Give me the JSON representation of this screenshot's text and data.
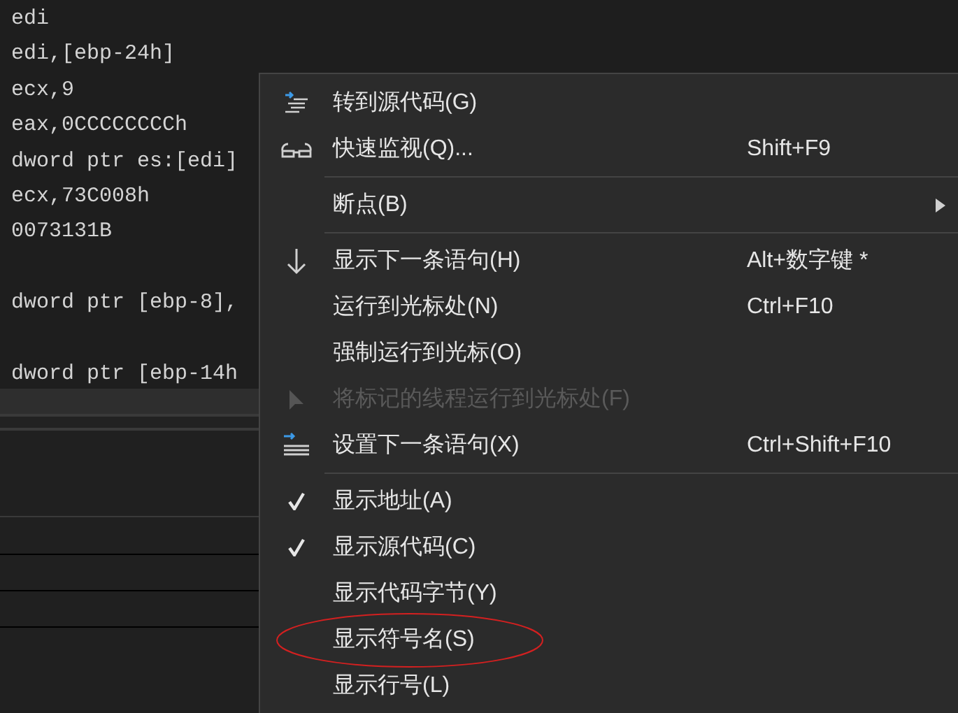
{
  "code_lines": [
    {
      "kind": "code",
      "text": "edi"
    },
    {
      "kind": "code",
      "text": "edi,[ebp-24h]"
    },
    {
      "kind": "code",
      "text": "ecx,9"
    },
    {
      "kind": "code",
      "text": "eax,0CCCCCCCCh"
    },
    {
      "kind": "code",
      "text": "dword ptr es:[edi]"
    },
    {
      "kind": "code",
      "text": "ecx,73C008h"
    },
    {
      "kind": "code",
      "text": "0073131B"
    },
    {
      "kind": "blank"
    },
    {
      "kind": "code",
      "text": "dword ptr [ebp-8],"
    },
    {
      "kind": "blank"
    },
    {
      "kind": "code",
      "text": "dword ptr [ebp-14h"
    }
  ],
  "context_menu": [
    {
      "kind": "item",
      "label": "转到源代码(G)"
    },
    {
      "kind": "item",
      "label": "快速监视(Q)...",
      "shortcut": "Shift+F9"
    },
    {
      "kind": "separator"
    },
    {
      "kind": "item",
      "label": "断点(B)",
      "submenu": true
    },
    {
      "kind": "separator"
    },
    {
      "kind": "item",
      "label": "显示下一条语句(H)",
      "shortcut": "Alt+数字键 *"
    },
    {
      "kind": "item",
      "label": "运行到光标处(N)",
      "shortcut": "Ctrl+F10"
    },
    {
      "kind": "item",
      "label": "强制运行到光标(O)"
    },
    {
      "kind": "item",
      "label": "将标记的线程运行到光标处(F)",
      "disabled": true
    },
    {
      "kind": "item",
      "label": "设置下一条语句(X)",
      "shortcut": "Ctrl+Shift+F10"
    },
    {
      "kind": "separator"
    },
    {
      "kind": "item",
      "label": "显示地址(A)",
      "checked": true
    },
    {
      "kind": "item",
      "label": "显示源代码(C)",
      "checked": true
    },
    {
      "kind": "item",
      "label": "显示代码字节(Y)",
      "checked": false
    },
    {
      "kind": "item",
      "label": "显示符号名(S)",
      "checked": false,
      "circled": true
    },
    {
      "kind": "item",
      "label": "显示行号(L)",
      "checked": false
    }
  ]
}
